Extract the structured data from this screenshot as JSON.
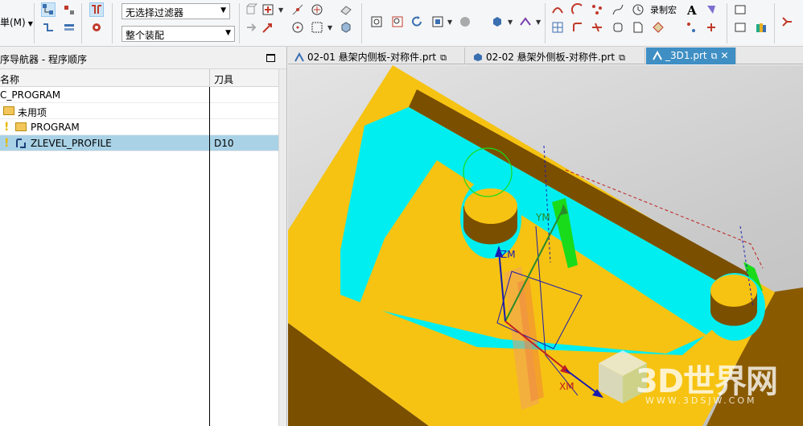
{
  "toolbar": {
    "menu_label": "単(M)",
    "filter_combo": "无选择过滤器",
    "assembly_combo": "整个装配",
    "record_macro": "录制宏"
  },
  "navigator": {
    "title": "序导航器 - 程序顺序",
    "col_name": "名称",
    "col_tool": "刀具",
    "rows": [
      {
        "label": "C_PROGRAM",
        "tool": ""
      },
      {
        "label": "未用项",
        "tool": ""
      },
      {
        "label": "PROGRAM",
        "tool": ""
      },
      {
        "label": "ZLEVEL_PROFILE",
        "tool": "D10"
      }
    ]
  },
  "tabs": [
    {
      "label": "02-01 悬架内侧板-对称件.prt",
      "active": false
    },
    {
      "label": "02-02 悬架外侧板-对称件.prt",
      "active": false
    },
    {
      "label": "_3D1.prt",
      "active": true
    }
  ],
  "viewport": {
    "axis_labels": {
      "ym": "YM",
      "zm": "ZM",
      "xm": "XM"
    },
    "watermark_title": "3D世界网",
    "watermark_sub": "WWW.3DSJW.COM"
  },
  "colors": {
    "part_top": "#f6c312",
    "part_side": "#8a5a00",
    "cyan": "#00f0f0",
    "accent_tab": "#3f8fc4",
    "select_row": "#a9d2e6"
  }
}
